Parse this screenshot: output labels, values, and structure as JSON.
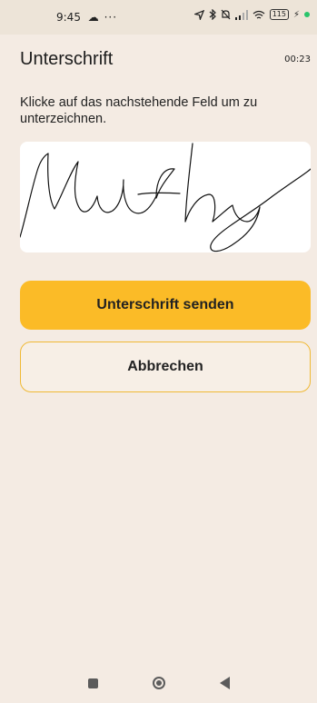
{
  "status_bar": {
    "time": "9:45",
    "extras": "☁ ···",
    "icons": [
      "location-icon",
      "bluetooth-icon",
      "silent-icon",
      "signal-icon",
      "wifi-icon",
      "battery-icon"
    ],
    "battery_level": "115"
  },
  "header": {
    "title": "Unterschrift",
    "timer": "00:23"
  },
  "main": {
    "instruction": "Klicke auf das nachstehende Feld um zu unterzeichnen.",
    "send_label": "Unterschrift senden",
    "cancel_label": "Abbrechen"
  },
  "colors": {
    "background": "#f4ebe3",
    "accent": "#fbbb27",
    "cancel_border": "#f0b935"
  },
  "nav": {
    "icons": [
      "recents-icon",
      "home-icon",
      "back-icon"
    ]
  }
}
